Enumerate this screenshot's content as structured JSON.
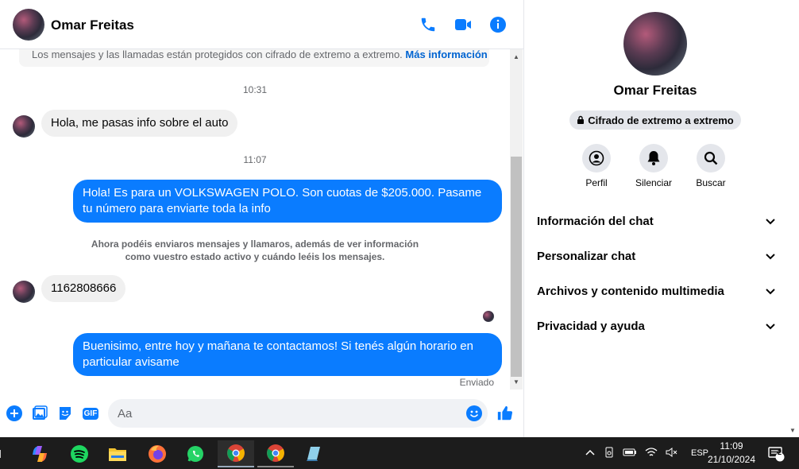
{
  "header": {
    "name": "Omar Freitas",
    "icons": [
      "phone-icon",
      "video-camera-icon",
      "info-icon"
    ]
  },
  "notice": {
    "text": "Los mensajes y las llamadas están protegidos con cifrado de extremo a extremo.",
    "link": "Más información"
  },
  "messages": {
    "time1": "10:31",
    "msg1": "Hola, me pasas info sobre el auto",
    "time2": "11:07",
    "msg2": "Hola! Es para un VOLKSWAGEN POLO. Son cuotas de $205.000. Pasame tu número para enviarte toda la info",
    "system": "Ahora podéis enviaros mensajes y llamaros, además de ver información como vuestro estado activo y cuándo leéis los mensajes.",
    "msg3": "1162808666",
    "msg4": "Buenisimo, entre hoy y mañana te contactamos! Si tenés algún horario en particular avisame",
    "status": "Enviado"
  },
  "composer": {
    "placeholder": "Aa",
    "icons": [
      "plus-icon",
      "gallery-icon",
      "sticker-icon",
      "gif-icon",
      "emoji-icon",
      "like-icon"
    ],
    "gif_label": "GIF"
  },
  "panel": {
    "name": "Omar Freitas",
    "encryption": "Cifrado de extremo a extremo",
    "actions": [
      "Perfil",
      "Silenciar",
      "Buscar"
    ],
    "sections": [
      "Información del chat",
      "Personalizar chat",
      "Archivos y contenido multimedia",
      "Privacidad y ayuda"
    ]
  },
  "taskbar": {
    "apps": [
      "copilot",
      "spotify",
      "file-explorer",
      "firefox",
      "whatsapp",
      "chrome",
      "chrome",
      "notepad"
    ],
    "language": "ESP",
    "time": "11:09",
    "date": "21/10/2024",
    "notifications": "2"
  },
  "colors": {
    "accent": "#0a7cff",
    "bubble_in": "#f0f0f0",
    "taskbar": "#1c1c1c"
  }
}
